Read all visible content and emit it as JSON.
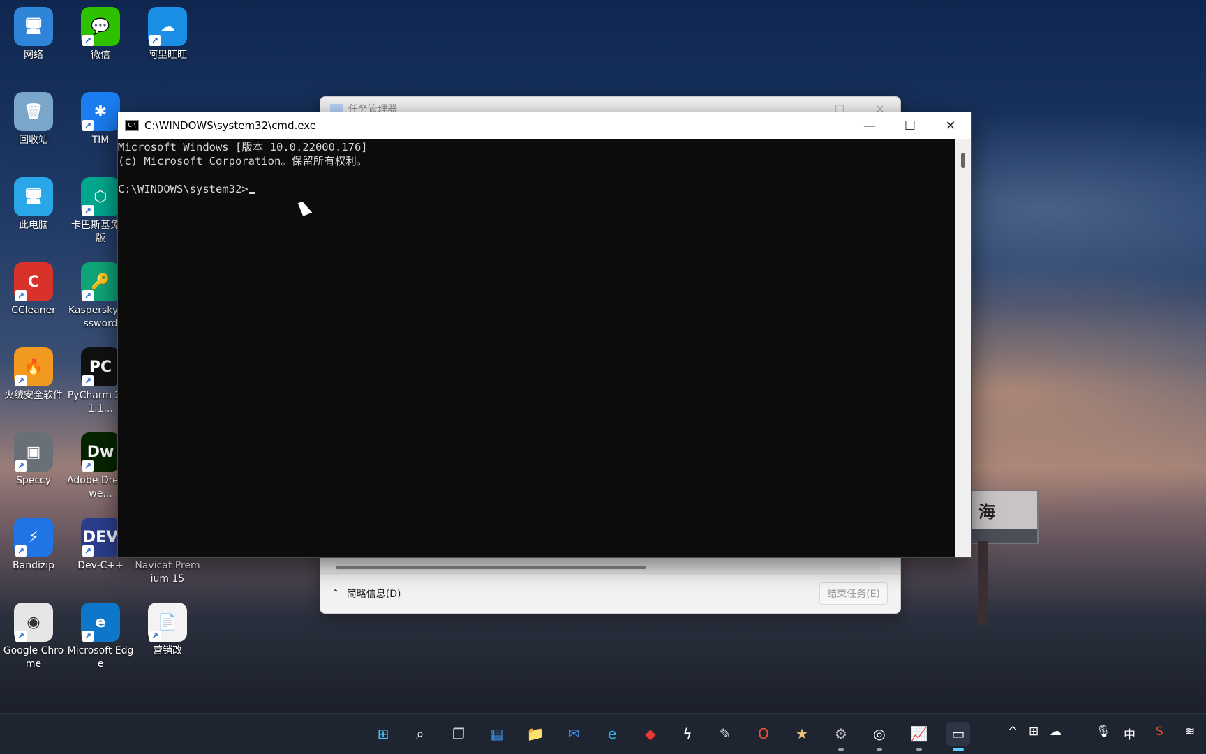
{
  "desktop_icons": [
    {
      "label": "网络",
      "color": "#2f86d9",
      "glyph": "🖥"
    },
    {
      "label": "微信",
      "color": "#2dc100",
      "glyph": "💬"
    },
    {
      "label": "阿里旺旺",
      "color": "#1b8fe6",
      "glyph": "☁"
    },
    {
      "label": "回收站",
      "color": "#7aa6c9",
      "glyph": "🗑"
    },
    {
      "label": "TIM",
      "color": "#1a7df2",
      "glyph": "✱"
    },
    {
      "label": "此电脑",
      "color": "#2aa7e8",
      "glyph": "🖥"
    },
    {
      "label": "卡巴斯基免费版",
      "color": "#00a88e",
      "glyph": "⬡"
    },
    {
      "label": "CCleaner",
      "color": "#d8322b",
      "glyph": "C"
    },
    {
      "label": "Kaspersky Password",
      "color": "#0fa67a",
      "glyph": "🔑"
    },
    {
      "label": "火绒安全软件",
      "color": "#f29a1f",
      "glyph": "🔥"
    },
    {
      "label": "PyCharm 2021.1...",
      "color": "#111111",
      "glyph": "PC"
    },
    {
      "label": "Speccy",
      "color": "#6a7077",
      "glyph": "▣"
    },
    {
      "label": "Adobe Dreamwe...",
      "color": "#072401",
      "glyph": "Dw"
    },
    {
      "label": "Bandizip",
      "color": "#1f74e6",
      "glyph": "⚡"
    },
    {
      "label": "Dev-C++",
      "color": "#2c3f8f",
      "glyph": "DEV"
    },
    {
      "label": "Navicat Premium 15",
      "color": "#1f8fd8",
      "glyph": "N"
    },
    {
      "label": "Google Chrome",
      "color": "#e6e6e6",
      "glyph": "◉"
    },
    {
      "label": "Microsoft Edge",
      "color": "#0d77c9",
      "glyph": "e"
    },
    {
      "label": "营销改",
      "color": "#f3f3f3",
      "glyph": "📄"
    }
  ],
  "task_manager": {
    "title": "任务管理器",
    "fewer_details": "简略信息(D)",
    "end_task": "结束任务(E)"
  },
  "cmd": {
    "title": "C:\\WINDOWS\\system32\\cmd.exe",
    "icon_text": "C:\\",
    "lines": [
      "Microsoft Windows [版本 10.0.22000.176]",
      "(c) Microsoft Corporation。保留所有权利。",
      "",
      "C:\\WINDOWS\\system32>"
    ]
  },
  "window_buttons": {
    "minimize": "—",
    "maximize": "☐",
    "close": "✕"
  },
  "sign_text": "海",
  "taskbar": {
    "icons": [
      {
        "name": "start-icon",
        "glyph": "⊞",
        "color": "#4cc2ff"
      },
      {
        "name": "search-icon",
        "glyph": "⌕",
        "color": "#ffffff"
      },
      {
        "name": "task-view-icon",
        "glyph": "❐",
        "color": "#d0d0d0"
      },
      {
        "name": "widgets-icon",
        "glyph": "▦",
        "color": "#3a8ee6"
      },
      {
        "name": "file-explorer-icon",
        "glyph": "📁",
        "color": "#f5c242"
      },
      {
        "name": "mail-icon",
        "glyph": "✉",
        "color": "#3a8ee6"
      },
      {
        "name": "edge-icon",
        "glyph": "e",
        "color": "#2fb6e8"
      },
      {
        "name": "app-red-diamond-icon",
        "glyph": "◆",
        "color": "#e53935"
      },
      {
        "name": "lightning-app-icon",
        "glyph": "ϟ",
        "color": "#ffffff"
      },
      {
        "name": "pen-app-icon",
        "glyph": "✎",
        "color": "#dddddd"
      },
      {
        "name": "office-icon",
        "glyph": "O",
        "color": "#e5532d"
      },
      {
        "name": "game-app-icon",
        "glyph": "★",
        "color": "#f0c27a"
      },
      {
        "name": "settings-icon",
        "glyph": "⚙",
        "color": "#c0c0c0"
      },
      {
        "name": "obs-icon",
        "glyph": "◎",
        "color": "#ffffff"
      },
      {
        "name": "task-manager-icon",
        "glyph": "📈",
        "color": "#8fc4ff"
      },
      {
        "name": "terminal-icon",
        "glyph": "▭",
        "color": "#ffffff"
      }
    ],
    "tray": {
      "chevron": "^",
      "ime": "中"
    }
  }
}
